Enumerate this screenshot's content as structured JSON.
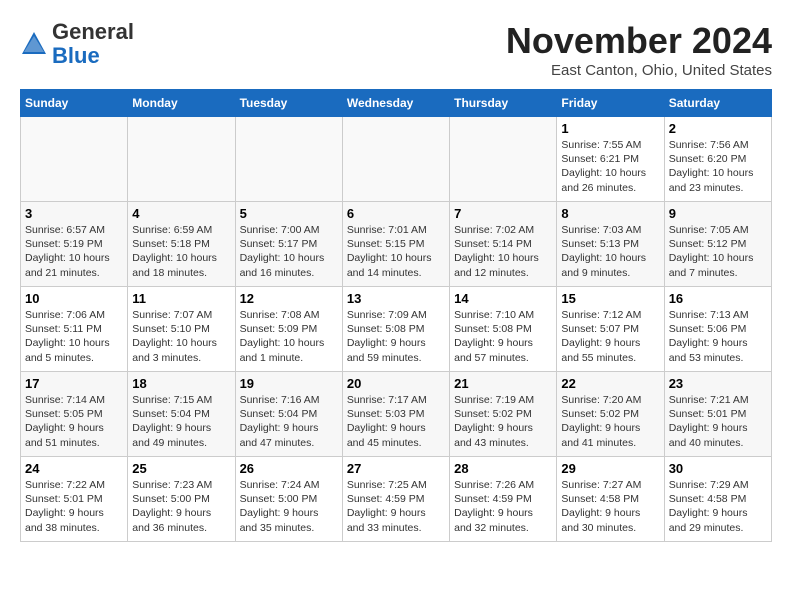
{
  "header": {
    "logo_line1": "General",
    "logo_line2": "Blue",
    "month": "November 2024",
    "location": "East Canton, Ohio, United States"
  },
  "days_of_week": [
    "Sunday",
    "Monday",
    "Tuesday",
    "Wednesday",
    "Thursday",
    "Friday",
    "Saturday"
  ],
  "weeks": [
    {
      "days": [
        {
          "num": "",
          "info": ""
        },
        {
          "num": "",
          "info": ""
        },
        {
          "num": "",
          "info": ""
        },
        {
          "num": "",
          "info": ""
        },
        {
          "num": "",
          "info": ""
        },
        {
          "num": "1",
          "info": "Sunrise: 7:55 AM\nSunset: 6:21 PM\nDaylight: 10 hours\nand 26 minutes."
        },
        {
          "num": "2",
          "info": "Sunrise: 7:56 AM\nSunset: 6:20 PM\nDaylight: 10 hours\nand 23 minutes."
        }
      ]
    },
    {
      "days": [
        {
          "num": "3",
          "info": "Sunrise: 6:57 AM\nSunset: 5:19 PM\nDaylight: 10 hours\nand 21 minutes."
        },
        {
          "num": "4",
          "info": "Sunrise: 6:59 AM\nSunset: 5:18 PM\nDaylight: 10 hours\nand 18 minutes."
        },
        {
          "num": "5",
          "info": "Sunrise: 7:00 AM\nSunset: 5:17 PM\nDaylight: 10 hours\nand 16 minutes."
        },
        {
          "num": "6",
          "info": "Sunrise: 7:01 AM\nSunset: 5:15 PM\nDaylight: 10 hours\nand 14 minutes."
        },
        {
          "num": "7",
          "info": "Sunrise: 7:02 AM\nSunset: 5:14 PM\nDaylight: 10 hours\nand 12 minutes."
        },
        {
          "num": "8",
          "info": "Sunrise: 7:03 AM\nSunset: 5:13 PM\nDaylight: 10 hours\nand 9 minutes."
        },
        {
          "num": "9",
          "info": "Sunrise: 7:05 AM\nSunset: 5:12 PM\nDaylight: 10 hours\nand 7 minutes."
        }
      ]
    },
    {
      "days": [
        {
          "num": "10",
          "info": "Sunrise: 7:06 AM\nSunset: 5:11 PM\nDaylight: 10 hours\nand 5 minutes."
        },
        {
          "num": "11",
          "info": "Sunrise: 7:07 AM\nSunset: 5:10 PM\nDaylight: 10 hours\nand 3 minutes."
        },
        {
          "num": "12",
          "info": "Sunrise: 7:08 AM\nSunset: 5:09 PM\nDaylight: 10 hours\nand 1 minute."
        },
        {
          "num": "13",
          "info": "Sunrise: 7:09 AM\nSunset: 5:08 PM\nDaylight: 9 hours\nand 59 minutes."
        },
        {
          "num": "14",
          "info": "Sunrise: 7:10 AM\nSunset: 5:08 PM\nDaylight: 9 hours\nand 57 minutes."
        },
        {
          "num": "15",
          "info": "Sunrise: 7:12 AM\nSunset: 5:07 PM\nDaylight: 9 hours\nand 55 minutes."
        },
        {
          "num": "16",
          "info": "Sunrise: 7:13 AM\nSunset: 5:06 PM\nDaylight: 9 hours\nand 53 minutes."
        }
      ]
    },
    {
      "days": [
        {
          "num": "17",
          "info": "Sunrise: 7:14 AM\nSunset: 5:05 PM\nDaylight: 9 hours\nand 51 minutes."
        },
        {
          "num": "18",
          "info": "Sunrise: 7:15 AM\nSunset: 5:04 PM\nDaylight: 9 hours\nand 49 minutes."
        },
        {
          "num": "19",
          "info": "Sunrise: 7:16 AM\nSunset: 5:04 PM\nDaylight: 9 hours\nand 47 minutes."
        },
        {
          "num": "20",
          "info": "Sunrise: 7:17 AM\nSunset: 5:03 PM\nDaylight: 9 hours\nand 45 minutes."
        },
        {
          "num": "21",
          "info": "Sunrise: 7:19 AM\nSunset: 5:02 PM\nDaylight: 9 hours\nand 43 minutes."
        },
        {
          "num": "22",
          "info": "Sunrise: 7:20 AM\nSunset: 5:02 PM\nDaylight: 9 hours\nand 41 minutes."
        },
        {
          "num": "23",
          "info": "Sunrise: 7:21 AM\nSunset: 5:01 PM\nDaylight: 9 hours\nand 40 minutes."
        }
      ]
    },
    {
      "days": [
        {
          "num": "24",
          "info": "Sunrise: 7:22 AM\nSunset: 5:01 PM\nDaylight: 9 hours\nand 38 minutes."
        },
        {
          "num": "25",
          "info": "Sunrise: 7:23 AM\nSunset: 5:00 PM\nDaylight: 9 hours\nand 36 minutes."
        },
        {
          "num": "26",
          "info": "Sunrise: 7:24 AM\nSunset: 5:00 PM\nDaylight: 9 hours\nand 35 minutes."
        },
        {
          "num": "27",
          "info": "Sunrise: 7:25 AM\nSunset: 4:59 PM\nDaylight: 9 hours\nand 33 minutes."
        },
        {
          "num": "28",
          "info": "Sunrise: 7:26 AM\nSunset: 4:59 PM\nDaylight: 9 hours\nand 32 minutes."
        },
        {
          "num": "29",
          "info": "Sunrise: 7:27 AM\nSunset: 4:58 PM\nDaylight: 9 hours\nand 30 minutes."
        },
        {
          "num": "30",
          "info": "Sunrise: 7:29 AM\nSunset: 4:58 PM\nDaylight: 9 hours\nand 29 minutes."
        }
      ]
    }
  ]
}
